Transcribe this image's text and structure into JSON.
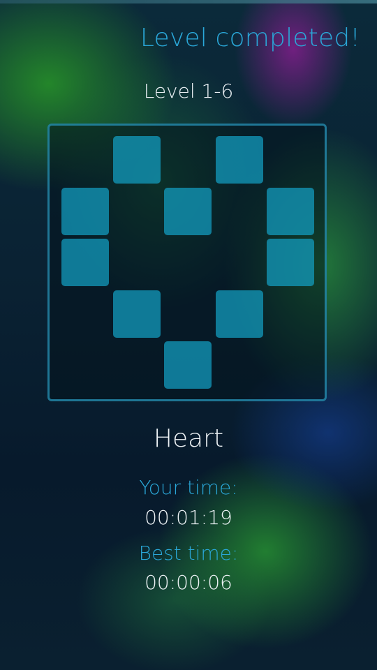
{
  "header": {
    "title": "Level completed!"
  },
  "level": {
    "label": "Level 1-6"
  },
  "puzzle": {
    "name": "Heart",
    "grid_columns": 5,
    "grid_rows": 5,
    "filled_cells": [
      [
        0,
        1
      ],
      [
        0,
        3
      ],
      [
        1,
        0
      ],
      [
        1,
        2
      ],
      [
        1,
        4
      ],
      [
        2,
        0
      ],
      [
        2,
        4
      ],
      [
        3,
        1
      ],
      [
        3,
        3
      ],
      [
        4,
        2
      ]
    ]
  },
  "stats": {
    "your_time_label": "Your time:",
    "your_time_value": "00:01:19",
    "best_time_label": "Best time:",
    "best_time_value": "00:00:06"
  },
  "colors": {
    "accent": "#2aa7d8",
    "tile": "#14a0c3",
    "text": "#eef3f6"
  }
}
